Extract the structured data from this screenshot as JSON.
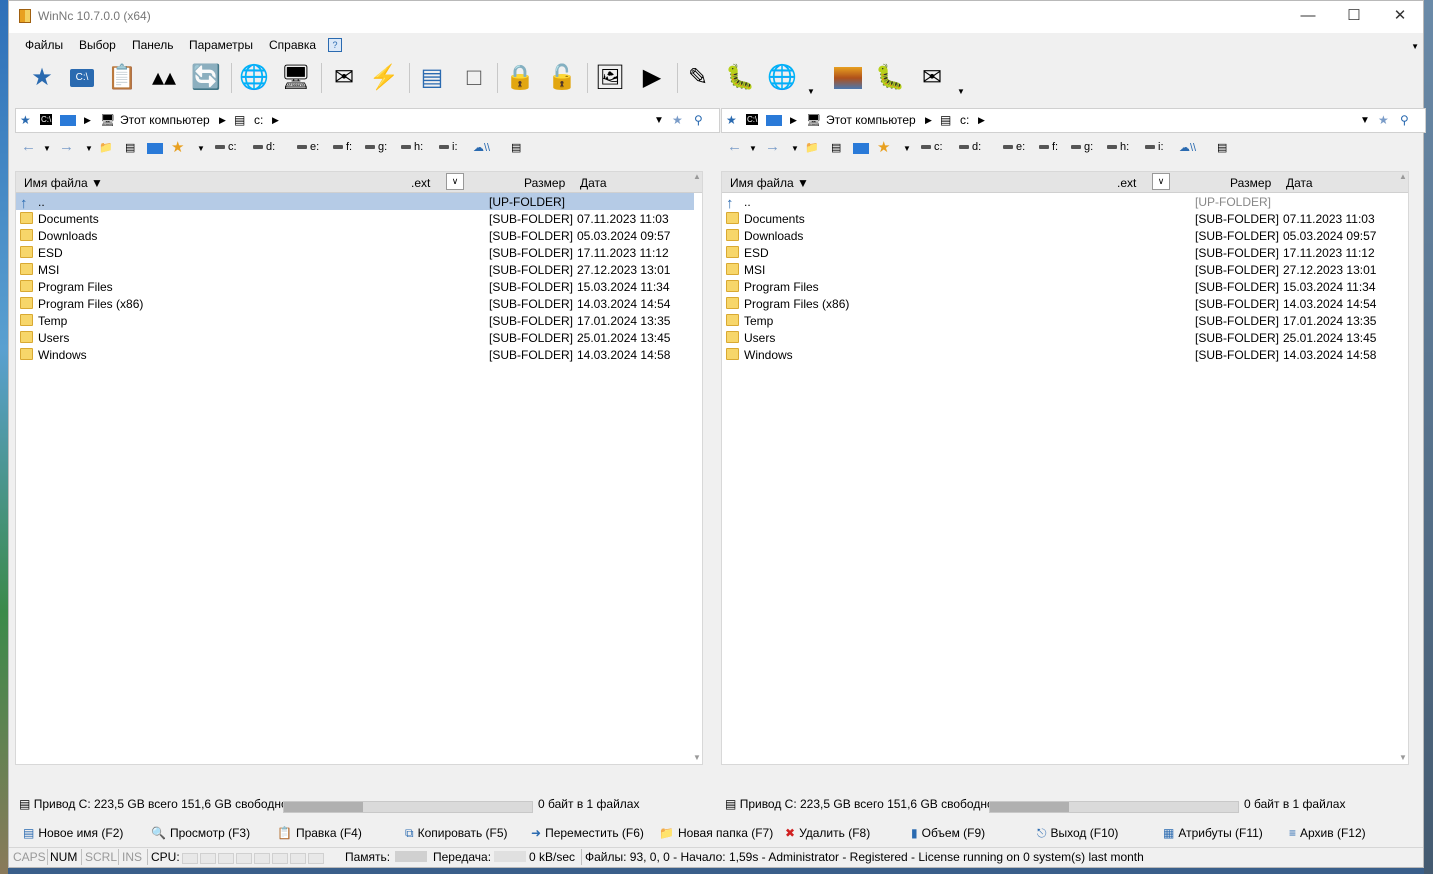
{
  "window": {
    "title": "WinNc 10.7.0.0 (x64)"
  },
  "menu": [
    "Файлы",
    "Выбор",
    "Панель",
    "Параметры",
    "Справка"
  ],
  "path": {
    "computer": "Этот компьютер",
    "drive": "c:",
    "cmd": "C:\\"
  },
  "drives": [
    "c:",
    "d:",
    "e:",
    "f:",
    "g:",
    "h:",
    "i:",
    "\\\\"
  ],
  "columns": {
    "name": "Имя файла",
    "ext": ".ext",
    "size": "Размер",
    "date": "Дата"
  },
  "up_row": {
    "name": "..",
    "size": "[UP-FOLDER]"
  },
  "files": [
    {
      "name": "Documents",
      "size": "[SUB-FOLDER]",
      "date": "07.11.2023 11:03"
    },
    {
      "name": "Downloads",
      "size": "[SUB-FOLDER]",
      "date": "05.03.2024 09:57"
    },
    {
      "name": "ESD",
      "size": "[SUB-FOLDER]",
      "date": "17.11.2023 11:12"
    },
    {
      "name": "MSI",
      "size": "[SUB-FOLDER]",
      "date": "27.12.2023 13:01"
    },
    {
      "name": "Program Files",
      "size": "[SUB-FOLDER]",
      "date": "15.03.2024 11:34"
    },
    {
      "name": "Program Files (x86)",
      "size": "[SUB-FOLDER]",
      "date": "14.03.2024 14:54"
    },
    {
      "name": "Temp",
      "size": "[SUB-FOLDER]",
      "date": "17.01.2024 13:35"
    },
    {
      "name": "Users",
      "size": "[SUB-FOLDER]",
      "date": "25.01.2024 13:45"
    },
    {
      "name": "Windows",
      "size": "[SUB-FOLDER]",
      "date": "14.03.2024 14:58"
    }
  ],
  "panel_status": {
    "drive_text": "Привод C: 223,5 GB всего 151,6 GB свободно",
    "files_text": "0 байт в 1 файлах",
    "used_fraction": 0.32
  },
  "fkeys": [
    {
      "label": "Новое имя (F2)",
      "icon": "rename-icon",
      "glyph": "▤"
    },
    {
      "label": "Просмотр (F3)",
      "icon": "view-icon",
      "glyph": "🔍"
    },
    {
      "label": "Правка (F4)",
      "icon": "edit-icon",
      "glyph": "📋"
    },
    {
      "label": "Копировать (F5)",
      "icon": "copy-icon",
      "glyph": "⧉"
    },
    {
      "label": "Переместить (F6)",
      "icon": "move-icon",
      "glyph": "➜"
    },
    {
      "label": "Новая папка (F7)",
      "icon": "new-folder-icon",
      "glyph": "📁"
    },
    {
      "label": "Удалить (F8)",
      "icon": "delete-icon",
      "glyph": "✖"
    },
    {
      "label": "Объем (F9)",
      "icon": "size-icon",
      "glyph": "▮"
    },
    {
      "label": "Выход (F10)",
      "icon": "exit-icon",
      "glyph": "⎋"
    },
    {
      "label": "Атрибуты (F11)",
      "icon": "attributes-icon",
      "glyph": "▦"
    },
    {
      "label": "Архив (F12)",
      "icon": "archive-icon",
      "glyph": "≡"
    }
  ],
  "bottom": {
    "caps": "CAPS",
    "num": "NUM",
    "scrl": "SCRL",
    "ins": "INS",
    "cpu": "CPU:",
    "mem": "Память:",
    "transfer": "Передача:",
    "speed": "0 kB/sec",
    "info": "Файлы: 93, 0, 0 - Начало: 1,59s - Administrator - Registered - License running on 0 system(s) last month"
  },
  "colors": {
    "selection": "#b5cbe6",
    "accent": "#2a6ab0",
    "folder": "#f7d66a"
  }
}
